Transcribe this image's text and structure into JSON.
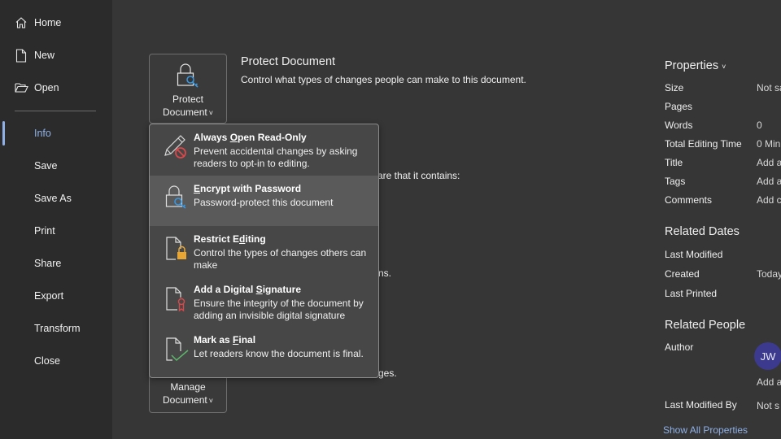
{
  "sidebar": {
    "items": [
      {
        "label": "Home",
        "icon": "home-icon"
      },
      {
        "label": "New",
        "icon": "new-document-icon"
      },
      {
        "label": "Open",
        "icon": "folder-open-icon"
      },
      {
        "label": "Info",
        "active": true
      },
      {
        "label": "Save"
      },
      {
        "label": "Save As"
      },
      {
        "label": "Print"
      },
      {
        "label": "Share"
      },
      {
        "label": "Export"
      },
      {
        "label": "Transform"
      },
      {
        "label": "Close"
      }
    ]
  },
  "main": {
    "protect_button": {
      "line1": "Protect",
      "line2": "Document",
      "chevron": "˅"
    },
    "protect_section": {
      "title": "Protect Document",
      "description": "Control what types of changes people can make to this document."
    },
    "inspect_fragment": "are that it contains:",
    "inspect_fragment2": "ns.",
    "manage_fragment": "ges.",
    "manage_button": {
      "line1": "Manage",
      "line2": "Document",
      "chevron": "˅"
    }
  },
  "menu": {
    "items": [
      {
        "title_pre": "Always ",
        "title_u": "O",
        "title_post": "pen Read-Only",
        "description": "Prevent accidental changes by asking readers to opt-in to editing.",
        "icon": "pencil-no-icon"
      },
      {
        "title_pre": "",
        "title_u": "E",
        "title_post": "ncrypt with Password",
        "description": "Password-protect this document",
        "icon": "lock-key-icon",
        "hovered": true
      },
      {
        "title_pre": "Restrict E",
        "title_u": "d",
        "title_post": "iting",
        "description": "Control the types of changes others can make",
        "icon": "document-lock-icon"
      },
      {
        "title_pre": "Add a Digital ",
        "title_u": "S",
        "title_post": "ignature",
        "description": "Ensure the integrity of the document by adding an invisible digital signature",
        "icon": "document-ribbon-icon"
      },
      {
        "title_pre": "Mark as ",
        "title_u": "F",
        "title_post": "inal",
        "description": "Let readers know the document is final.",
        "icon": "document-check-icon"
      }
    ]
  },
  "properties": {
    "heading": "Properties",
    "chevron": "˅",
    "rows": [
      {
        "label": "Size",
        "value": "Not sa"
      },
      {
        "label": "Pages",
        "value": ""
      },
      {
        "label": "Words",
        "value": "0"
      },
      {
        "label": "Total Editing Time",
        "value": "0 Min"
      },
      {
        "label": "Title",
        "value": "Add a"
      },
      {
        "label": "Tags",
        "value": "Add a"
      },
      {
        "label": "Comments",
        "value": "Add c"
      }
    ],
    "related_dates": {
      "heading": "Related Dates",
      "rows": [
        {
          "label": "Last Modified",
          "value": ""
        },
        {
          "label": "Created",
          "value": "Today"
        },
        {
          "label": "Last Printed",
          "value": ""
        }
      ]
    },
    "related_people": {
      "heading": "Related People",
      "author_label": "Author",
      "author_initials": "JW",
      "add_author": "Add a",
      "last_modified_by_label": "Last Modified By",
      "last_modified_by_value": "Not s"
    },
    "show_all": "Show All Properties"
  }
}
